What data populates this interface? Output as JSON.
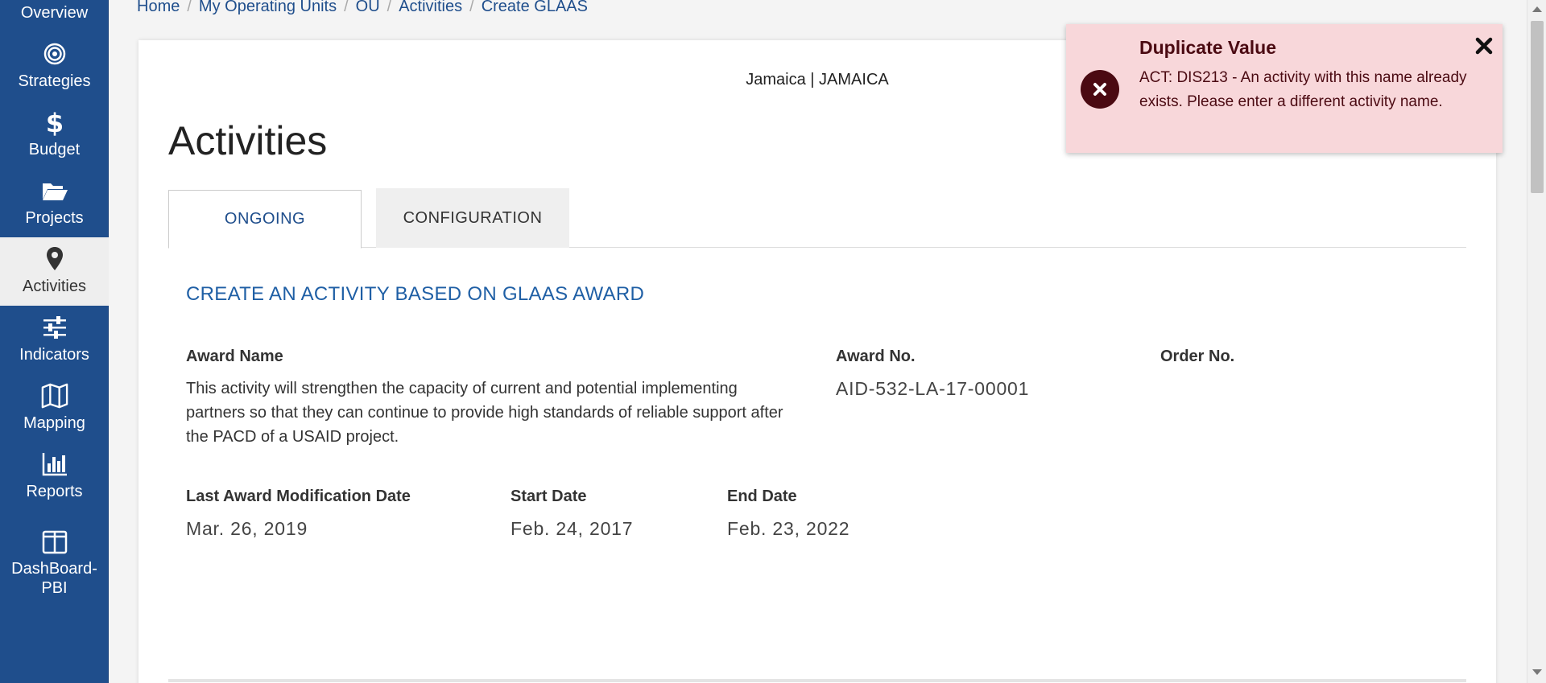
{
  "sidebar": {
    "items": [
      {
        "label": "Overview",
        "icon": "overview-icon"
      },
      {
        "label": "Strategies",
        "icon": "target-icon"
      },
      {
        "label": "Budget",
        "icon": "dollar-icon"
      },
      {
        "label": "Projects",
        "icon": "folder-open-icon"
      },
      {
        "label": "Activities",
        "icon": "map-marker-icon",
        "active": true
      },
      {
        "label": "Indicators",
        "icon": "sliders-icon"
      },
      {
        "label": "Mapping",
        "icon": "map-icon"
      },
      {
        "label": "Reports",
        "icon": "bar-chart-icon"
      },
      {
        "label": "DashBoard-PBI",
        "icon": "columns-icon"
      }
    ]
  },
  "breadcrumb": [
    "Home",
    "My Operating Units",
    "OU",
    "Activities",
    "Create GLAAS"
  ],
  "ou_label": "Jamaica | JAMAICA",
  "page_title": "Activities",
  "tabs": {
    "ongoing": "ONGOING",
    "configuration": "CONFIGURATION"
  },
  "section_title": "CREATE AN ACTIVITY BASED ON GLAAS AWARD",
  "award": {
    "name_label": "Award Name",
    "name_value": "This activity will strengthen the capacity of current and potential implementing partners so that they can continue to provide high standards of reliable support after the PACD of a USAID project.",
    "no_label": "Award No.",
    "no_value": "AID-532-LA-17-00001",
    "order_label": "Order No.",
    "last_mod_label": "Last Award Modification Date",
    "last_mod_value": "Mar. 26, 2019",
    "start_label": "Start Date",
    "start_value": "Feb. 24, 2017",
    "end_label": "End Date",
    "end_value": "Feb. 23, 2022"
  },
  "toast": {
    "title": "Duplicate Value",
    "message": "ACT: DIS213 - An activity with this name already exists. Please enter a different activity name."
  },
  "colors": {
    "sidebar_bg": "#1f4e8c",
    "link": "#1f4e8c",
    "section_title": "#1f5fa5",
    "toast_bg": "#f8d7da",
    "toast_text": "#4b0a12"
  }
}
